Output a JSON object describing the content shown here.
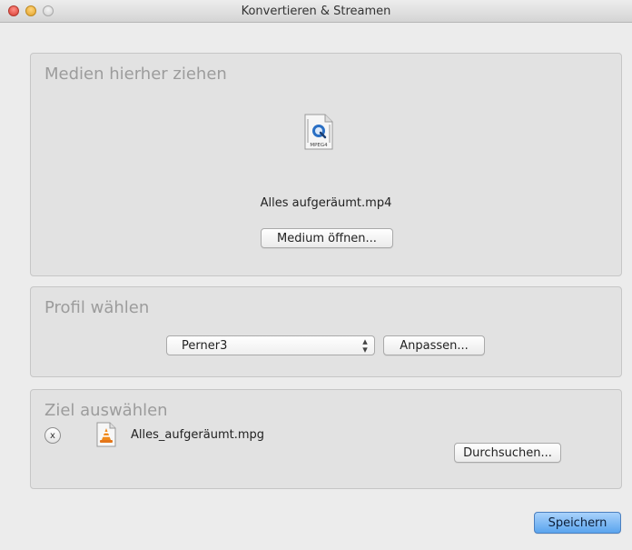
{
  "window": {
    "title": "Konvertieren & Streamen"
  },
  "source": {
    "heading": "Medien hierher ziehen",
    "file_type_label": "MPEG4",
    "file_name": "Alles aufgeräumt.mp4",
    "open_button": "Medium öffnen..."
  },
  "profile": {
    "heading": "Profil wählen",
    "selected": "Perner3",
    "customize_button": "Anpassen..."
  },
  "destination": {
    "heading": "Ziel auswählen",
    "remove_label": "x",
    "file_name": "Alles_aufgeräumt.mpg",
    "browse_button": "Durchsuchen..."
  },
  "footer": {
    "save_button": "Speichern"
  },
  "colors": {
    "accent": "#5aa4ee",
    "close": "#d63a30",
    "minimize": "#e0a12a"
  },
  "icons": [
    "mpeg4-file-icon",
    "vlc-file-icon",
    "remove-icon",
    "popup-arrows-icon"
  ]
}
